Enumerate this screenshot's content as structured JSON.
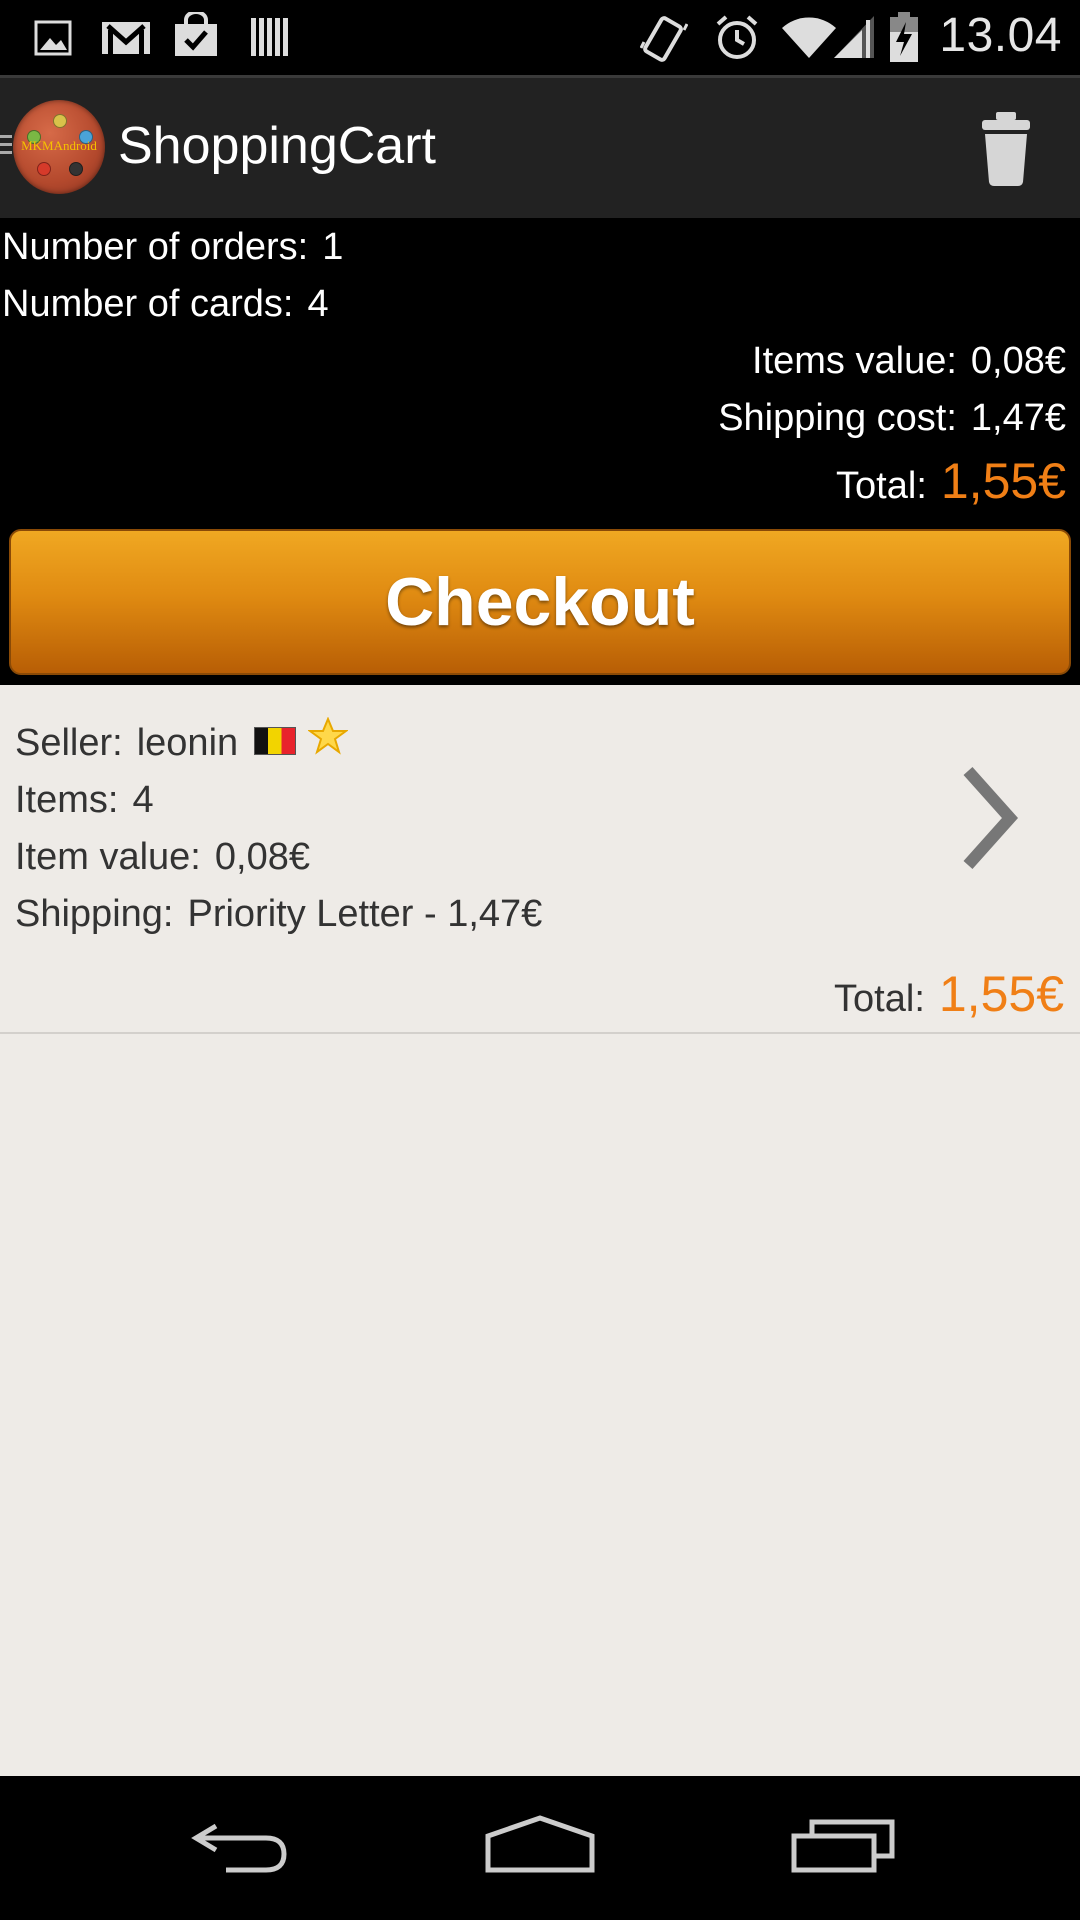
{
  "status_bar": {
    "time": "13.04",
    "left_icons": [
      "image-icon",
      "gmail-icon",
      "shopping-bag-icon",
      "barcode-icon"
    ],
    "right_icons": [
      "vibrate-icon",
      "alarm-icon",
      "wifi-icon",
      "signal-icon",
      "battery-charging-icon"
    ]
  },
  "action_bar": {
    "logo_text": "MKMAndroid",
    "title": "ShoppingCart",
    "trash_icon": "trash-icon"
  },
  "summary": {
    "orders_label": "Number of orders:",
    "orders_value": "1",
    "cards_label": "Number of cards:",
    "cards_value": "4",
    "items_value_label": "Items value:",
    "items_value": "0,08€",
    "shipping_cost_label": "Shipping cost:",
    "shipping_cost": "1,47€",
    "total_label": "Total:",
    "total_value": "1,55€",
    "total_color": "#f07f16"
  },
  "checkout": {
    "label": "Checkout",
    "color": "#e08b12"
  },
  "orders": [
    {
      "seller_label": "Seller:",
      "seller": "leonin",
      "seller_country_icon": "belgium-flag-icon",
      "seller_rating_icon": "star-icon",
      "items_label": "Items:",
      "items": "4",
      "item_value_label": "Item value:",
      "item_value": "0,08€",
      "shipping_label": "Shipping:",
      "shipping": "Priority Letter - 1,47€",
      "total_label": "Total:",
      "total": "1,55€"
    }
  ],
  "nav_bar": {
    "buttons": [
      "back-icon",
      "home-icon",
      "recent-apps-icon"
    ]
  }
}
